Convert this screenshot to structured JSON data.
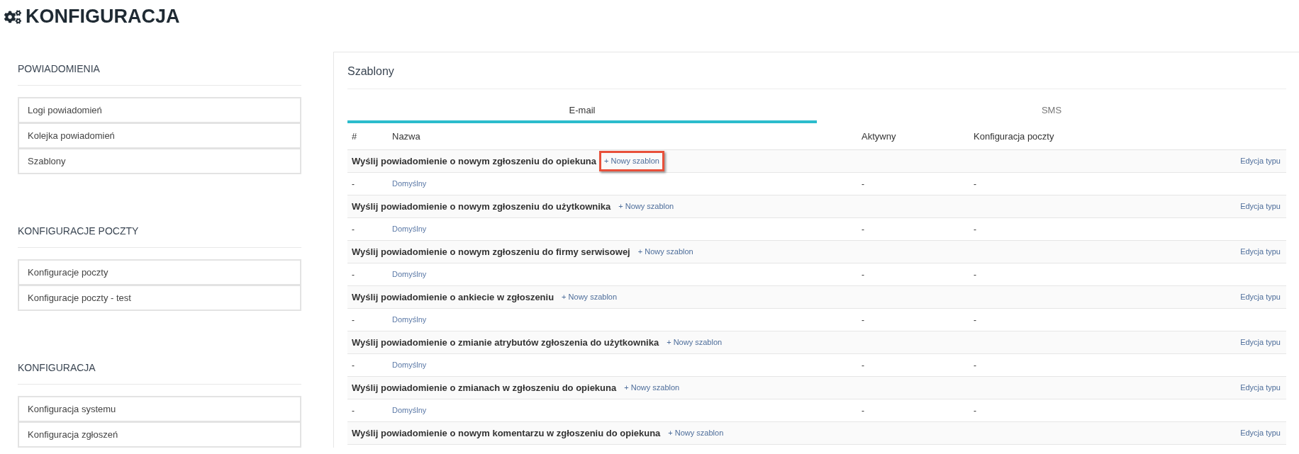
{
  "page_title": "KONFIGURACJA",
  "sidebar": [
    {
      "heading": "POWIADOMIENIA",
      "items": [
        {
          "label": "Logi powiadomień"
        },
        {
          "label": "Kolejka powiadomień"
        },
        {
          "label": "Szablony"
        }
      ]
    },
    {
      "heading": "KONFIGURACJE POCZTY",
      "items": [
        {
          "label": "Konfiguracje poczty"
        },
        {
          "label": "Konfiguracje poczty - test"
        }
      ]
    },
    {
      "heading": "KONFIGURACJA",
      "items": [
        {
          "label": "Konfiguracja systemu"
        },
        {
          "label": "Konfiguracja zgłoszeń"
        }
      ]
    }
  ],
  "panel": {
    "title": "Szablony",
    "tabs": [
      {
        "label": "E-mail",
        "selected": true
      },
      {
        "label": "SMS",
        "selected": false
      }
    ],
    "table": {
      "columns": [
        "#",
        "Nazwa",
        "Aktywny",
        "Konfiguracja poczty"
      ],
      "groups": [
        {
          "title": "Wyślij powiadomienie o nowym zgłoszeniu do opiekuna",
          "action": "+ Nowy szablon",
          "highlighted": true,
          "edit": "Edycja typu",
          "templates": [
            {
              "number": "-",
              "name": "Domyślny",
              "active": "-",
              "mail_config": "-"
            }
          ]
        },
        {
          "title": "Wyślij powiadomienie o nowym zgłoszeniu do użytkownika",
          "action": "+ Nowy szablon",
          "highlighted": false,
          "edit": "Edycja typu",
          "templates": [
            {
              "number": "-",
              "name": "Domyślny",
              "active": "-",
              "mail_config": "-"
            }
          ]
        },
        {
          "title": "Wyślij powiadomienie o nowym zgłoszeniu do firmy serwisowej",
          "action": "+ Nowy szablon",
          "highlighted": false,
          "edit": "Edycja typu",
          "templates": [
            {
              "number": "-",
              "name": "Domyślny",
              "active": "-",
              "mail_config": "-"
            }
          ]
        },
        {
          "title": "Wyślij powiadomienie o ankiecie w zgłoszeniu",
          "action": "+ Nowy szablon",
          "highlighted": false,
          "edit": "Edycja typu",
          "templates": [
            {
              "number": "-",
              "name": "Domyślny",
              "active": "-",
              "mail_config": "-"
            }
          ]
        },
        {
          "title": "Wyślij powiadomienie o zmianie atrybutów zgłoszenia do użytkownika",
          "action": "+ Nowy szablon",
          "highlighted": false,
          "edit": "Edycja typu",
          "templates": [
            {
              "number": "-",
              "name": "Domyślny",
              "active": "-",
              "mail_config": "-"
            }
          ]
        },
        {
          "title": "Wyślij powiadomienie o zmianach w zgłoszeniu do opiekuna",
          "action": "+ Nowy szablon",
          "highlighted": false,
          "edit": "Edycja typu",
          "templates": [
            {
              "number": "-",
              "name": "Domyślny",
              "active": "-",
              "mail_config": "-"
            }
          ]
        },
        {
          "title": "Wyślij powiadomienie o nowym komentarzu w zgłoszeniu do opiekuna",
          "action": "+ Nowy szablon",
          "highlighted": false,
          "edit": "Edycja typu"
        }
      ]
    }
  }
}
